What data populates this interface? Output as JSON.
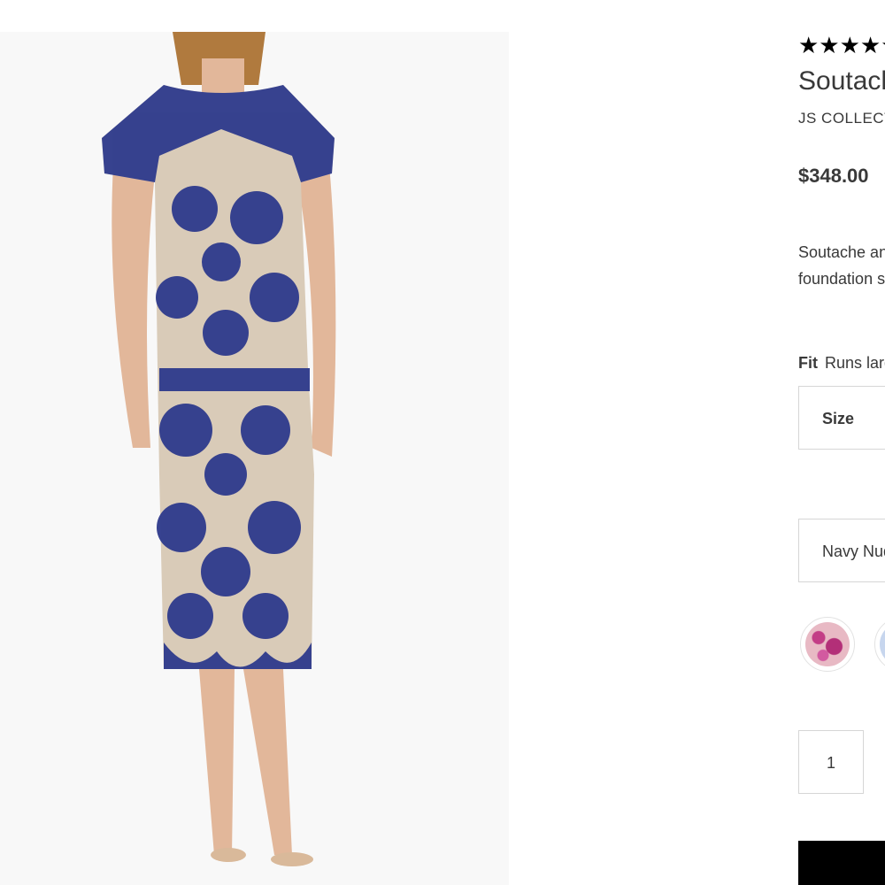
{
  "product": {
    "image_alt": "Navy soutache lace cap-sleeve midi dress",
    "rating_stars": "★★★★★",
    "title": "Soutache Lace Cocktail Dress",
    "brand": "JS COLLECTIONS",
    "price": "$348.00",
    "description_line1": "Soutache and embroidered lace over a contrast",
    "description_line2": "foundation shapes this cap-sleeve midi dress."
  },
  "fit": {
    "label": "Fit",
    "value": "Runs large; order one size smaller"
  },
  "size_select": {
    "label": "Size"
  },
  "color_select": {
    "value": "Navy Nude"
  },
  "swatches": [
    {
      "name": "Fuchsia",
      "color": "#c33d86"
    },
    {
      "name": "Blue",
      "color": "#7a9bd0"
    }
  ],
  "quantity": {
    "value": "1"
  },
  "colors": {
    "dress_navy": "#2e3a8c",
    "lining_nude": "#d9cbb8",
    "skin": "#e2b79a",
    "button_black": "#000000"
  }
}
